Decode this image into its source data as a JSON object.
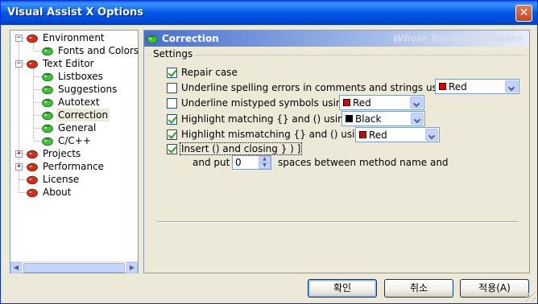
{
  "window": {
    "title": "Visual Assist X Options",
    "close_glyph": "✕"
  },
  "tree": {
    "items": [
      {
        "label": "Environment",
        "level": 0,
        "expander": "−",
        "icon": "tomato-red-icon"
      },
      {
        "label": "Fonts and Colors",
        "level": 1,
        "icon": "tomato-green-icon"
      },
      {
        "label": "Text Editor",
        "level": 0,
        "expander": "−",
        "icon": "tomato-red-icon"
      },
      {
        "label": "Listboxes",
        "level": 1,
        "icon": "tomato-green-icon"
      },
      {
        "label": "Suggestions",
        "level": 1,
        "icon": "tomato-green-icon"
      },
      {
        "label": "Autotext",
        "level": 1,
        "icon": "tomato-green-icon"
      },
      {
        "label": "Correction",
        "level": 1,
        "icon": "tomato-green-icon",
        "selected": true
      },
      {
        "label": "General",
        "level": 1,
        "icon": "tomato-green-icon"
      },
      {
        "label": "C/C++",
        "level": 1,
        "icon": "tomato-green-icon"
      },
      {
        "label": "Projects",
        "level": 0,
        "expander": "+",
        "icon": "tomato-red-icon"
      },
      {
        "label": "Performance",
        "level": 0,
        "expander": "+",
        "icon": "tomato-red-icon"
      },
      {
        "label": "License",
        "level": 0,
        "icon": "tomato-red-icon"
      },
      {
        "label": "About",
        "level": 0,
        "icon": "tomato-red-icon"
      }
    ]
  },
  "pane": {
    "title": "Correction",
    "brand": "Whole Tomato Software",
    "group_label": "Settings",
    "options": {
      "repair_case": {
        "label": "Repair case",
        "checked": true
      },
      "underline_spelling": {
        "label": "Underline spelling errors in comments and strings usir",
        "checked": false,
        "color_label": "Red",
        "color": "#e00000"
      },
      "underline_mistyped": {
        "label": "Underline mistyped symbols usin",
        "checked": false,
        "color_label": "Red",
        "color": "#e00000"
      },
      "highlight_matching": {
        "label": "Highlight matching {} and () using",
        "checked": true,
        "color_label": "Black",
        "color": "#000000"
      },
      "highlight_mismatching": {
        "label": "Highlight mismatching {} and () usin",
        "checked": true,
        "color_label": "Red",
        "color": "#e00000"
      },
      "insert_closing": {
        "label": "Insert () and closing } ) ]",
        "checked": true
      },
      "spaces_prefix": "and put",
      "spaces_value": "0",
      "spaces_suffix": "spaces between method name and"
    }
  },
  "buttons": {
    "ok": "확인",
    "cancel": "취소",
    "apply": "적용(A)"
  },
  "colors": {
    "accent": "#0058e6",
    "tomato_red": "#d62b1d",
    "tomato_green": "#2fb52f"
  }
}
